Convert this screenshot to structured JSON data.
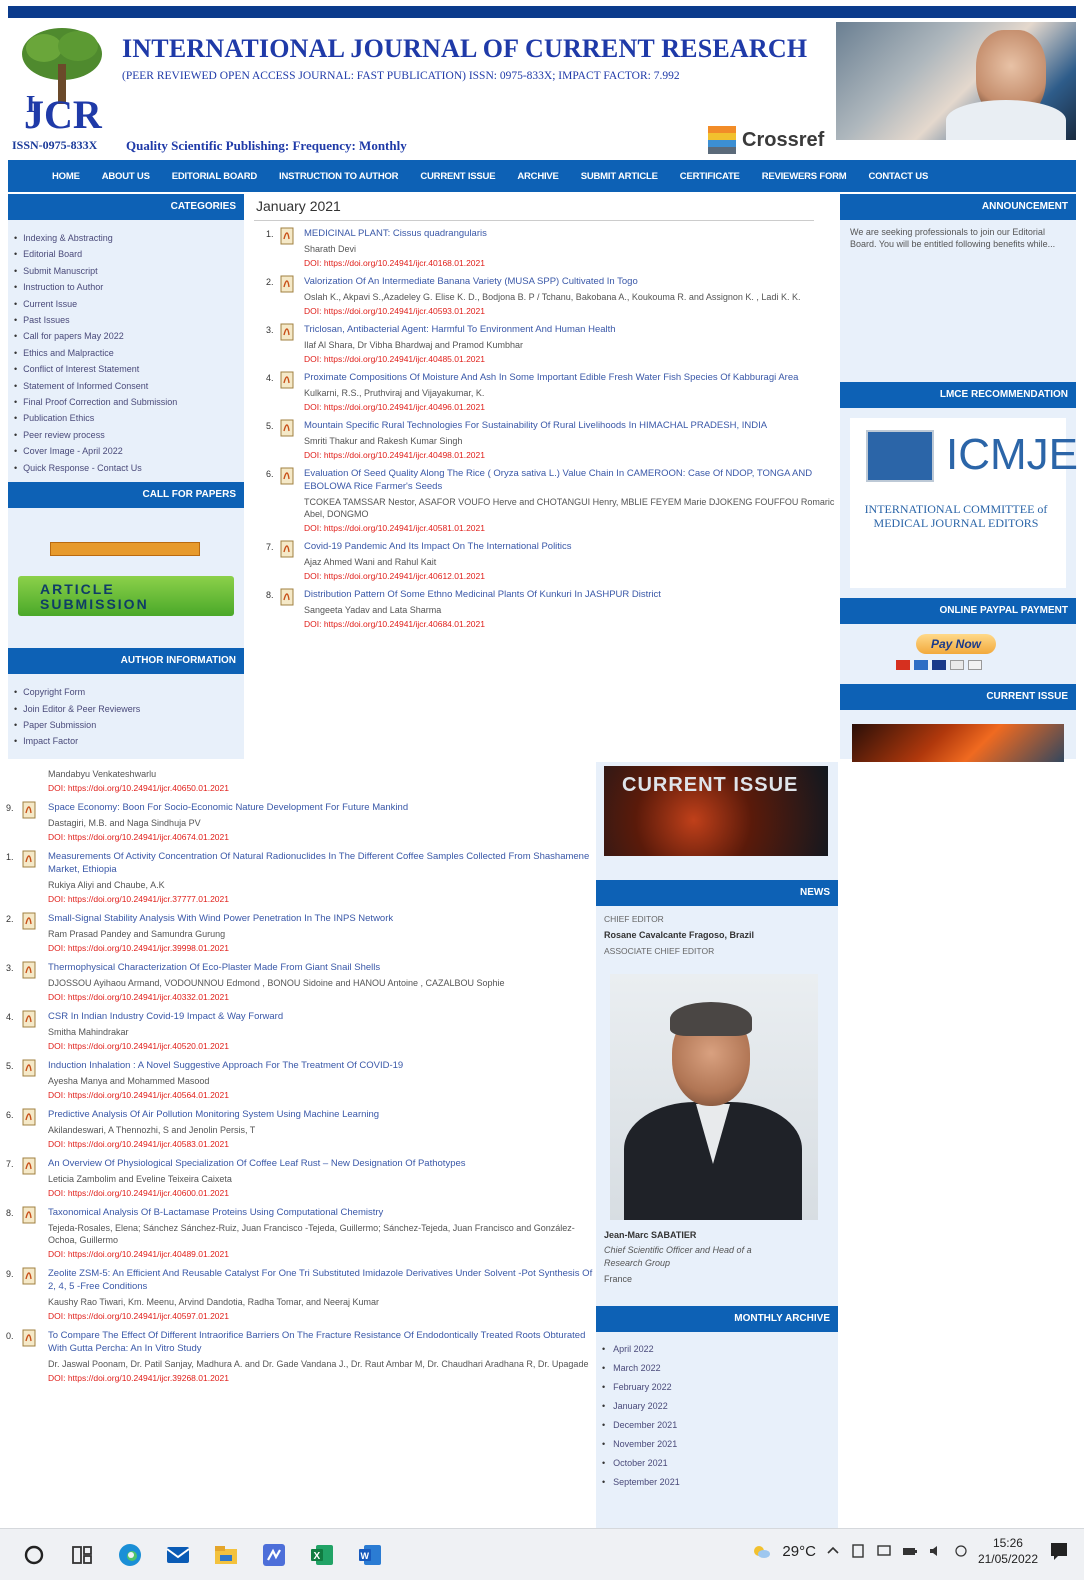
{
  "header": {
    "title": "INTERNATIONAL JOURNAL OF CURRENT RESEARCH",
    "subtitle": "(PEER REVIEWED OPEN ACCESS JOURNAL: FAST PUBLICATION) ISSN: 0975-833X; IMPACT FACTOR: 7.992",
    "issn_left": "ISSN-0975-833X",
    "quality": "Quality Scientific Publishing: Frequency: Monthly",
    "crossref": "Crossref",
    "logo_text": "IJCR"
  },
  "nav": [
    "HOME",
    "ABOUT US",
    "EDITORIAL BOARD",
    "INSTRUCTION TO AUTHOR",
    "CURRENT ISSUE",
    "ARCHIVE",
    "SUBMIT ARTICLE",
    "CERTIFICATE",
    "REVIEWERS FORM",
    "CONTACT US"
  ],
  "left": {
    "categories_title": "CATEGORIES",
    "categories": [
      "Indexing & Abstracting",
      "Editorial Board",
      "Submit Manuscript",
      "Instruction to Author",
      "Current Issue",
      "Past Issues",
      "Call for papers May 2022",
      "Ethics and Malpractice",
      "Conflict of Interest Statement",
      "Statement of Informed Consent",
      "Final Proof Correction and Submission",
      "Publication Ethics",
      "Peer review process",
      "Cover Image - April 2022",
      "Quick Response - Contact Us"
    ],
    "cfp_title": "CALL FOR PAPERS",
    "submission_line1": "ARTICLE",
    "submission_line2": "SUBMISSION",
    "author_title": "AUTHOR INFORMATION",
    "author_items": [
      "Copyright Form",
      "Join Editor & Peer Reviewers",
      "Paper Submission",
      "Impact Factor"
    ]
  },
  "main": {
    "title": "January 2021",
    "articles": [
      {
        "num": "1.",
        "title": "MEDICINAL PLANT: Cissus quadrangularis",
        "authors": "Sharath Devi",
        "doi": "DOI: https://doi.org/10.24941/ijcr.40168.01.2021"
      },
      {
        "num": "2.",
        "title": "Valorization Of An Intermediate Banana Variety (MUSA SPP) Cultivated In Togo",
        "authors": "Oslah K., Akpavi S.,Azadeley G. Elise K. D., Bodjona B. P / Tchanu, Bakobana A., Koukouma R. and Assignon K. , Ladi K. K.",
        "doi": "DOI: https://doi.org/10.24941/ijcr.40593.01.2021"
      },
      {
        "num": "3.",
        "title": "Triclosan, Antibacterial Agent: Harmful To Environment And Human Health",
        "authors": "Ilaf Al Shara, Dr Vibha Bhardwaj and Pramod Kumbhar",
        "doi": "DOI: https://doi.org/10.24941/ijcr.40485.01.2021"
      },
      {
        "num": "4.",
        "title": "Proximate Compositions Of Moisture And Ash In Some Important Edible Fresh Water Fish Species Of Kabburagi Area",
        "authors": "Kulkarni, R.S., Pruthviraj and Vijayakumar, K.",
        "doi": "DOI: https://doi.org/10.24941/ijcr.40496.01.2021"
      },
      {
        "num": "5.",
        "title": "Mountain Specific Rural Technologies For Sustainability Of Rural Livelihoods In HIMACHAL PRADESH, INDIA",
        "authors": "Smriti Thakur and Rakesh Kumar Singh",
        "doi": "DOI: https://doi.org/10.24941/ijcr.40498.01.2021"
      },
      {
        "num": "6.",
        "title": "Evaluation Of Seed Quality Along The Rice ( Oryza sativa L.) Value Chain In CAMEROON: Case Of NDOP, TONGA AND EBOLOWA Rice Farmer's Seeds",
        "authors": "TCOKEA TAMSSAR Nestor, ASAFOR VOUFO Herve and CHOTANGUI Henry, MBLIE FEYEM Marie DJOKENG FOUFFOU Romaric Abel, DONGMO",
        "doi": "DOI: https://doi.org/10.24941/ijcr.40581.01.2021"
      },
      {
        "num": "7.",
        "title": "Covid-19 Pandemic And Its Impact On The International Politics",
        "authors": "Ajaz Ahmed Wani and Rahul Kait",
        "doi": "DOI: https://doi.org/10.24941/ijcr.40612.01.2021"
      },
      {
        "num": "8.",
        "title": "Distribution Pattern Of Some Ethno Medicinal Plants Of Kunkuri In JASHPUR District",
        "authors": "Sangeeta Yadav and Lata Sharma",
        "doi": "DOI: https://doi.org/10.24941/ijcr.40684.01.2021"
      }
    ]
  },
  "right": {
    "announcement_title": "ANNOUNCEMENT",
    "announcement_text": "We are seeking professionals to join our Editorial Board. You will be entitled following benefits while...",
    "lmce_title": "LMCE RECOMMENDATION",
    "icmje_logo": "ICMJE",
    "icmje_sub": "INTERNATIONAL COMMITTEE of MEDICAL JOURNAL EDITORS",
    "paypal_title": "ONLINE PAYPAL PAYMENT",
    "paynow": "Pay Now",
    "current_issue_title": "CURRENT ISSUE"
  },
  "lower": {
    "partial_authors": "Mandabyu Venkateshwarlu",
    "partial_doi": "DOI: https://doi.org/10.24941/ijcr.40650.01.2021",
    "articles": [
      {
        "num": "9.",
        "title": "Space Economy: Boon For Socio-Economic Nature Development For Future Mankind",
        "authors": "Dastagiri, M.B. and Naga Sindhuja PV",
        "doi": "DOI: https://doi.org/10.24941/ijcr.40674.01.2021"
      },
      {
        "num": "1.",
        "title": "Measurements Of Activity Concentration Of Natural Radionuclides In The Different Coffee Samples Collected From Shashamene Market, Ethiopia",
        "authors": "Rukiya Aliyi and Chaube, A.K",
        "doi": "DOI: https://doi.org/10.24941/ijcr.37777.01.2021"
      },
      {
        "num": "2.",
        "title": "Small-Signal Stability Analysis With Wind Power Penetration In The INPS Network",
        "authors": "Ram Prasad Pandey and Samundra Gurung",
        "doi": "DOI: https://doi.org/10.24941/ijcr.39998.01.2021"
      },
      {
        "num": "3.",
        "title": "Thermophysical Characterization Of Eco-Plaster Made From Giant Snail Shells",
        "authors": "DJOSSOU Ayihaou Armand, VODOUNNOU Edmond , BONOU Sidoine and HANOU Antoine , CAZALBOU Sophie",
        "doi": "DOI: https://doi.org/10.24941/ijcr.40332.01.2021"
      },
      {
        "num": "4.",
        "title": "CSR In Indian Industry Covid-19 Impact & Way Forward",
        "authors": "Smitha Mahindrakar",
        "doi": "DOI: https://doi.org/10.24941/ijcr.40520.01.2021"
      },
      {
        "num": "5.",
        "title": "Induction Inhalation : A Novel Suggestive Approach For The Treatment Of COVID-19",
        "authors": "Ayesha Manya and Mohammed Masood",
        "doi": "DOI: https://doi.org/10.24941/ijcr.40564.01.2021"
      },
      {
        "num": "6.",
        "title": "Predictive Analysis Of Air Pollution Monitoring System Using Machine Learning",
        "authors": "Akilandeswari, A Thennozhi, S and Jenolin Persis, T",
        "doi": "DOI: https://doi.org/10.24941/ijcr.40583.01.2021"
      },
      {
        "num": "7.",
        "title": "An Overview Of Physiological Specialization Of Coffee Leaf Rust – New Designation Of Pathotypes",
        "authors": "Leticia Zambolim and Eveline Teixeira Caixeta",
        "doi": "DOI: https://doi.org/10.24941/ijcr.40600.01.2021"
      },
      {
        "num": "8.",
        "title": "Taxonomical Analysis Of B-Lactamase Proteins Using Computational Chemistry",
        "authors": "Tejeda-Rosales, Elena; Sánchez Sánchez-Ruiz, Juan Francisco -Tejeda, Guillermo; Sánchez-Tejeda, Juan Francisco and González-Ochoa, Guillermo",
        "doi": "DOI: https://doi.org/10.24941/ijcr.40489.01.2021"
      },
      {
        "num": "9.",
        "title": "Zeolite ZSM-5: An Efficient And Reusable Catalyst For One Tri Substituted Imidazole Derivatives Under Solvent -Pot Synthesis Of 2, 4, 5 -Free Conditions",
        "authors": "Kaushy Rao Tiwari, Km. Meenu, Arvind Dandotia, Radha Tomar, and Neeraj Kumar",
        "doi": "DOI: https://doi.org/10.24941/ijcr.40597.01.2021"
      },
      {
        "num": "0.",
        "title": "To Compare The Effect Of Different Intraorifice Barriers On The Fracture Resistance Of Endodontically Treated Roots Obturated With Gutta Percha: An In Vitro Study",
        "authors": "Dr. Jaswal Poonam, Dr. Patil Sanjay, Madhura A. and Dr. Gade Vandana J., Dr. Raut Ambar M, Dr. Chaudhari Aradhana R, Dr. Upagade",
        "doi": "DOI: https://doi.org/10.24941/ijcr.39268.01.2021"
      }
    ],
    "ci_text": "CURRENT ISSUE",
    "news_title": "NEWS",
    "chief_editor_label": "CHIEF EDITOR",
    "chief_editor": "Rosane Cavalcante Fragoso, Brazil",
    "assoc_label": "ASSOCIATE CHIEF EDITOR",
    "person_name": "Jean-Marc SABATIER",
    "person_role": "Chief Scientific Officer and Head of a Research Group",
    "person_country": "France",
    "archive_title": "MONTHLY ARCHIVE",
    "archive": [
      "April 2022",
      "March 2022",
      "February 2022",
      "January 2022",
      "December 2021",
      "November 2021",
      "October 2021",
      "September 2021"
    ]
  },
  "taskbar": {
    "temp": "29°C",
    "time": "15:26",
    "date": "21/05/2022"
  }
}
